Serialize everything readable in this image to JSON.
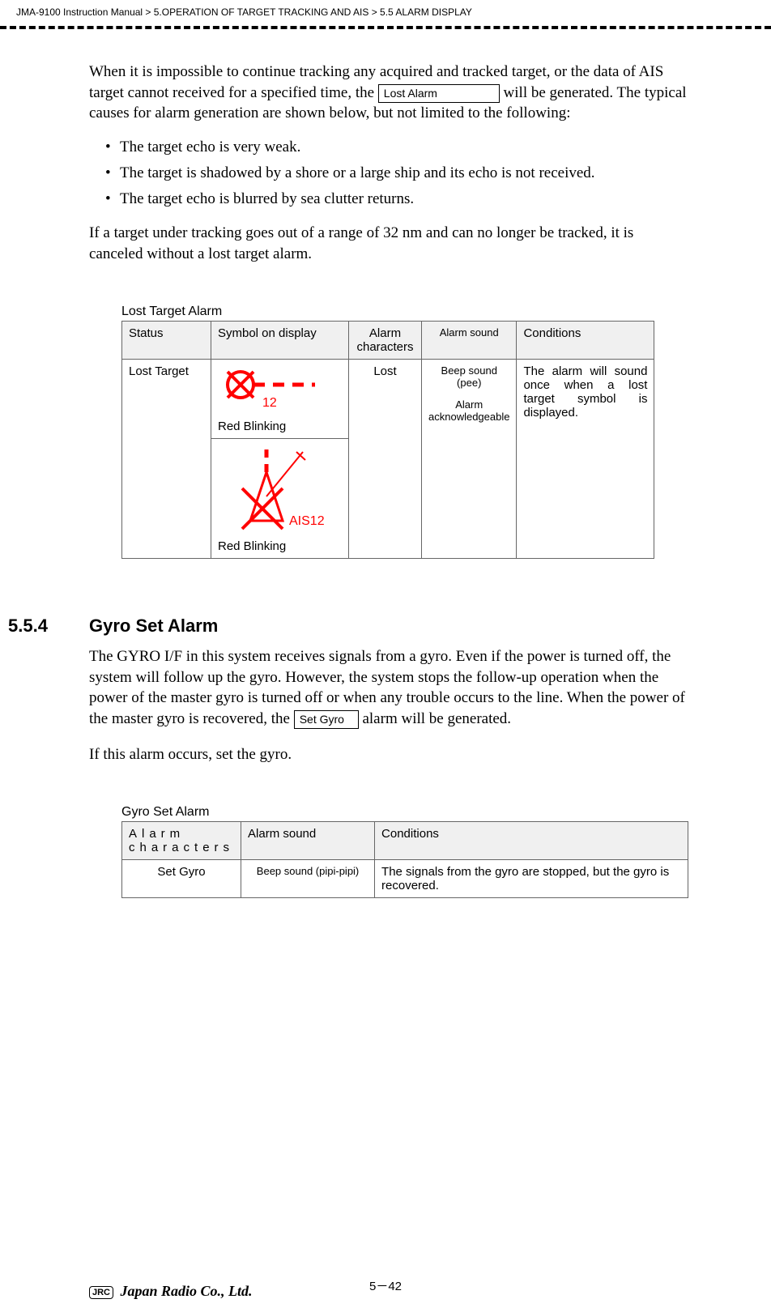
{
  "header": {
    "breadcrumb": "JMA-9100 Instruction Manual > 5.OPERATION OF TARGET TRACKING AND AIS > 5.5  ALARM DISPLAY"
  },
  "body": {
    "p1a": "When it is impossible to continue tracking any acquired and tracked target, or the data of AIS target cannot received for a specified time, the ",
    "lost_alarm_box": "Lost Alarm",
    "p1b": " will be generated. The typical causes for alarm generation are shown below, but not limited to the following:",
    "bullets": [
      "The target echo is very weak.",
      "The target is shadowed by a shore or a large ship and its echo is not received.",
      "The target echo is blurred by sea clutter returns."
    ],
    "p2": "If a target under tracking goes out of a range of 32 nm and can no longer be tracked, it is canceled without a lost target alarm."
  },
  "table1": {
    "caption": "Lost Target Alarm",
    "headers": {
      "status": "Status",
      "symbol": "Symbol on display",
      "alarm_chars": "Alarm characters",
      "alarm_sound": "Alarm sound",
      "conditions": "Conditions"
    },
    "row": {
      "status": "Lost Target",
      "symbol1_num": "12",
      "symbol1_label": "Red Blinking",
      "symbol2_num": "AIS12",
      "symbol2_label": "Red Blinking",
      "alarm_chars": "Lost",
      "alarm_sound_1": "Beep sound (pee)",
      "alarm_sound_2": "Alarm acknowledgeable",
      "conditions": "The alarm will sound once when a lost target symbol is displayed."
    }
  },
  "section": {
    "num": "5.5.4",
    "title": "Gyro Set Alarm",
    "p1a": "The GYRO I/F in this system receives signals from a gyro. Even if the power is turned off, the system will follow up the gyro. However, the system stops the follow-up operation when the power of the master gyro is turned off or when any trouble occurs to the line. When the power of the master gyro is recovered, the ",
    "set_gyro_box": "Set Gyro",
    "p1b": " alarm will be generated.",
    "p2": "If this alarm occurs, set the gyro."
  },
  "table2": {
    "caption": "Gyro Set Alarm",
    "headers": {
      "alarm_chars": "Alarm characters",
      "alarm_sound": "Alarm sound",
      "conditions": "Conditions"
    },
    "row": {
      "alarm_chars": "Set Gyro",
      "alarm_sound": "Beep sound (pipi-pipi)",
      "conditions": "The signals from the gyro are stopped, but the gyro is recovered."
    }
  },
  "footer": {
    "page": "5－42",
    "logo_box": "JRC",
    "logo_text": "Japan Radio Co., Ltd."
  }
}
